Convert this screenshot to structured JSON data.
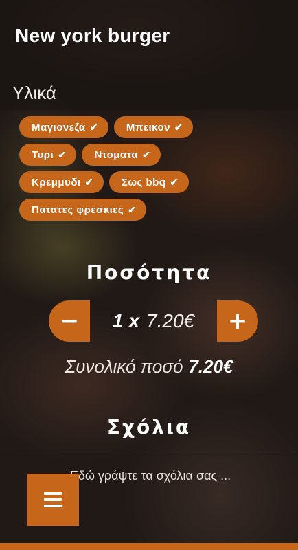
{
  "header": {
    "title": "New york burger"
  },
  "ingredients": {
    "label": "Υλικά",
    "rows": [
      [
        {
          "label": "Μαγιονεζα"
        },
        {
          "label": "Μπεικον"
        }
      ],
      [
        {
          "label": "Τυρι"
        },
        {
          "label": "Ντοματα"
        }
      ],
      [
        {
          "label": "Κρεμμυδι"
        },
        {
          "label": "Σως bbq"
        }
      ],
      [
        {
          "label": "Πατατες φρεσκιες"
        }
      ]
    ],
    "check_icon": "check-icon"
  },
  "quantity": {
    "title": "Ποσότητα",
    "count": "1",
    "times": "x",
    "unit_price": "7.20€",
    "minus_icon": "minus-icon",
    "plus_icon": "plus-icon"
  },
  "total": {
    "label": "Συνολικό ποσό",
    "amount": "7.20€"
  },
  "comments": {
    "title": "Σχόλια",
    "placeholder": "Εδώ γράψτε τα σχόλια σας ..."
  },
  "menu": {
    "icon": "hamburger-menu-icon"
  },
  "colors": {
    "accent": "#c5661a"
  }
}
